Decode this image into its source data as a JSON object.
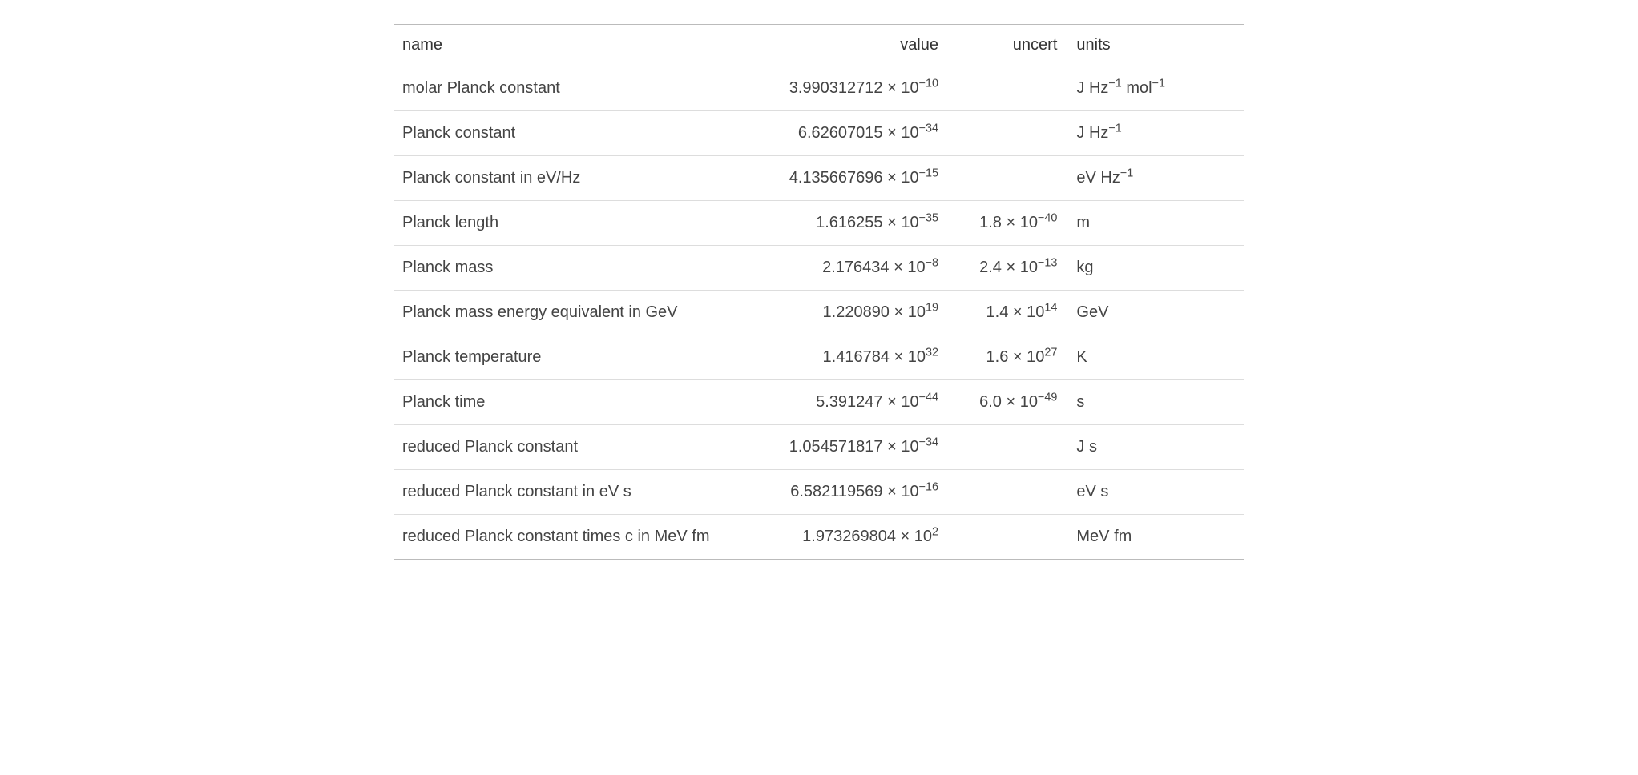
{
  "headers": {
    "name": "name",
    "value": "value",
    "uncert": "uncert",
    "units": "units"
  },
  "rows": [
    {
      "name": "molar Planck constant",
      "value_mantissa": "3.990312712 × 10",
      "value_exp": "−10",
      "uncert_mantissa": "",
      "uncert_exp": "",
      "units_html": "J Hz<sup>−1</sup> mol<sup>−1</sup>"
    },
    {
      "name": "Planck constant",
      "value_mantissa": "6.62607015 × 10",
      "value_exp": "−34",
      "uncert_mantissa": "",
      "uncert_exp": "",
      "units_html": "J Hz<sup>−1</sup>"
    },
    {
      "name": "Planck constant in eV/Hz",
      "value_mantissa": "4.135667696 × 10",
      "value_exp": "−15",
      "uncert_mantissa": "",
      "uncert_exp": "",
      "units_html": "eV Hz<sup>−1</sup>"
    },
    {
      "name": "Planck length",
      "value_mantissa": "1.616255 × 10",
      "value_exp": "−35",
      "uncert_mantissa": "1.8 × 10",
      "uncert_exp": "−40",
      "units_html": "m"
    },
    {
      "name": "Planck mass",
      "value_mantissa": "2.176434 × 10",
      "value_exp": "−8",
      "uncert_mantissa": "2.4 × 10",
      "uncert_exp": "−13",
      "units_html": "kg"
    },
    {
      "name": "Planck mass energy equivalent in GeV",
      "value_mantissa": "1.220890 × 10",
      "value_exp": "19",
      "uncert_mantissa": "1.4 × 10",
      "uncert_exp": "14",
      "units_html": "GeV"
    },
    {
      "name": "Planck temperature",
      "value_mantissa": "1.416784 × 10",
      "value_exp": "32",
      "uncert_mantissa": "1.6 × 10",
      "uncert_exp": "27",
      "units_html": "K"
    },
    {
      "name": "Planck time",
      "value_mantissa": "5.391247 × 10",
      "value_exp": "−44",
      "uncert_mantissa": "6.0 × 10",
      "uncert_exp": "−49",
      "units_html": "s"
    },
    {
      "name": "reduced Planck constant",
      "value_mantissa": "1.054571817 × 10",
      "value_exp": "−34",
      "uncert_mantissa": "",
      "uncert_exp": "",
      "units_html": "J s"
    },
    {
      "name": "reduced Planck constant in eV s",
      "value_mantissa": "6.582119569 × 10",
      "value_exp": "−16",
      "uncert_mantissa": "",
      "uncert_exp": "",
      "units_html": "eV s"
    },
    {
      "name": "reduced Planck constant times c in MeV fm",
      "value_mantissa": "1.973269804 × 10",
      "value_exp": "2",
      "uncert_mantissa": "",
      "uncert_exp": "",
      "units_html": "MeV fm"
    }
  ]
}
